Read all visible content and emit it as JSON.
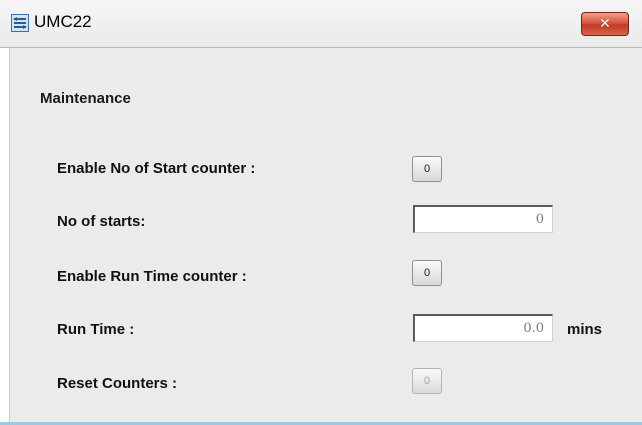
{
  "window": {
    "title": "UMC22",
    "close_label": "✕"
  },
  "section": {
    "title": "Maintenance"
  },
  "fields": {
    "enable_starts": {
      "label": "Enable No of Start counter :",
      "button": "0"
    },
    "no_of_starts": {
      "label": "No of starts:",
      "value": "0"
    },
    "enable_runtime": {
      "label": "Enable Run Time counter :",
      "button": "0"
    },
    "run_time": {
      "label": "Run Time :",
      "value": "0.0",
      "unit": "mins"
    },
    "reset": {
      "label": "Reset Counters :",
      "button": "0"
    }
  }
}
